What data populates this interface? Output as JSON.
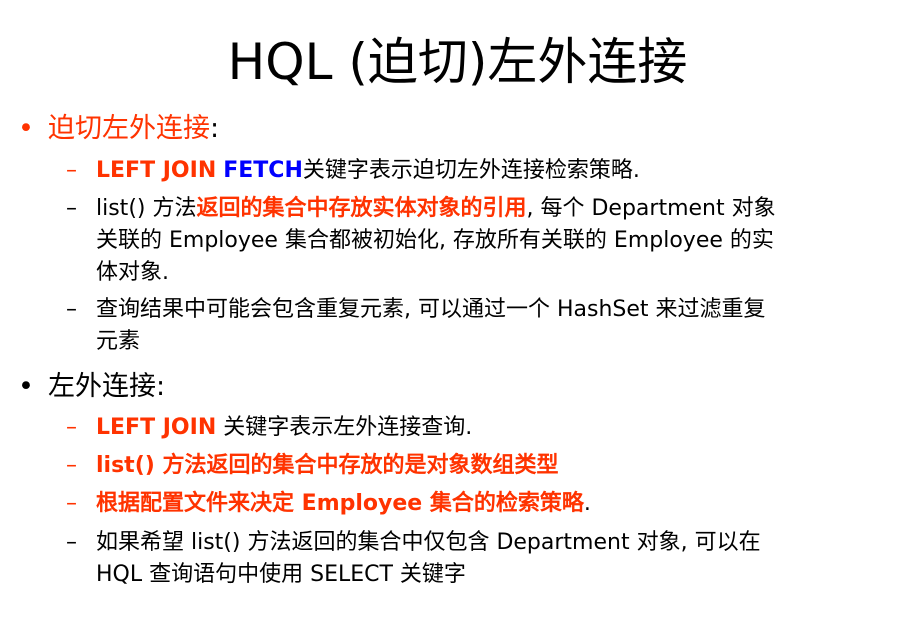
{
  "title": "HQL (迫切)左外连接",
  "section1": {
    "bullet": "•",
    "heading": "迫切左外连接",
    "heading_colon": ":",
    "items": [
      {
        "dash": "–",
        "kw1": "LEFT JOIN",
        "kw2": "FETCH",
        "rest": "关键字表示迫切左外连接检索策略."
      },
      {
        "dash": "–",
        "pre": "list() 方法",
        "highlight": "返回的集合中存放实体对象的引用",
        "line1_rest": ", 每个 Department 对象",
        "line2": "关联的 Employee  集合都被初始化, 存放所有关联的 Employee 的实",
        "line3": "体对象."
      },
      {
        "dash": "–",
        "line1": "查询结果中可能会包含重复元素, 可以通过一个 HashSet 来过滤重复",
        "line2": "元素"
      }
    ]
  },
  "section2": {
    "bullet": "•",
    "heading": "左外连接:",
    "items": [
      {
        "dash": "–",
        "kw": "LEFT JOIN",
        "rest": "关键字表示左外连接查询."
      },
      {
        "dash": "–",
        "text": "list() 方法返回的集合中存放的是对象数组类型"
      },
      {
        "dash": "–",
        "text": "根据配置文件来决定 Employee 集合的检索策略",
        "tail": "."
      },
      {
        "dash": "–",
        "line1": "如果希望 list() 方法返回的集合中仅包含 Department 对象, 可以在",
        "line2": "HQL 查询语句中使用 SELECT 关键字"
      }
    ]
  },
  "colors": {
    "red": "#ff3300",
    "blue": "#0000ff",
    "black": "#000000"
  }
}
